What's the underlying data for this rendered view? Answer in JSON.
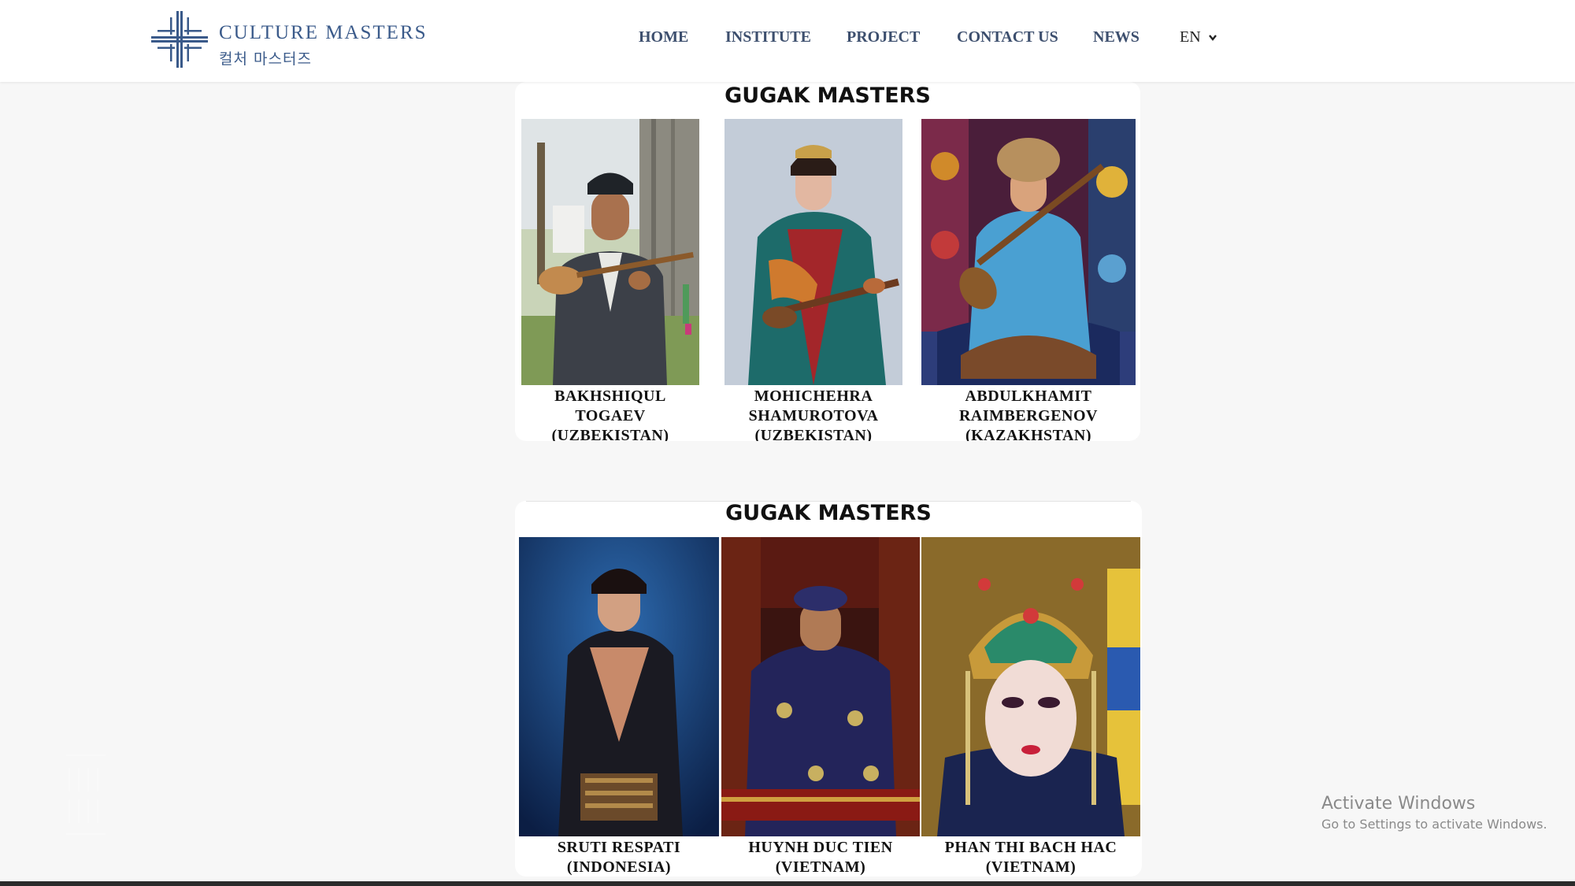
{
  "header": {
    "logo": {
      "title": "CULTURE MASTERS",
      "subtitle": "컬처 마스터즈",
      "brand_color": "#3a5a8a"
    },
    "nav": [
      {
        "label": "HOME"
      },
      {
        "label": "INSTITUTE"
      },
      {
        "label": "PROJECT"
      },
      {
        "label": "CONTACT US"
      },
      {
        "label": "NEWS"
      }
    ],
    "language": {
      "label": "EN",
      "icon": "chevron-down-icon"
    }
  },
  "sections": [
    {
      "title": "GUGAK MASTERS",
      "masters": [
        {
          "name_line1": "BAKHSHIQUL",
          "name_line2": "TOGAEV",
          "country": "(UZBEKISTAN)"
        },
        {
          "name_line1": "MOHICHEHRA",
          "name_line2": "SHAMUROTOVA",
          "country": "(UZBEKISTAN)"
        },
        {
          "name_line1": "ABDULKHAMIT",
          "name_line2": "RAIMBERGENOV",
          "country": "(KAZAKHSTAN)"
        }
      ]
    },
    {
      "title": "GUGAK MASTERS",
      "masters": [
        {
          "name_line1": "SRUTI RESPATI",
          "country": "(INDONESIA)"
        },
        {
          "name_line1": "HUYNH DUC TIEN",
          "country": "(VIETNAM)"
        },
        {
          "name_line1": "PHAN THI BACH HAC",
          "country": "(VIETNAM)"
        }
      ]
    }
  ],
  "os_watermark": {
    "line1": "Activate Windows",
    "line2": "Go to Settings to activate Windows."
  }
}
